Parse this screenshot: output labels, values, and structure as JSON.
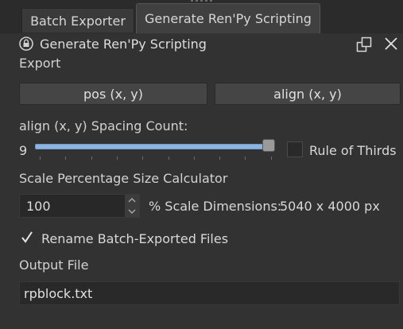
{
  "tabs": [
    {
      "label": "Batch Exporter",
      "active": false
    },
    {
      "label": "Generate Ren'Py Scripting",
      "active": true
    }
  ],
  "dock": {
    "title": "Generate Ren'Py Scripting",
    "icons": {
      "lock": "lock-icon",
      "float": "float-icon",
      "close": "close-icon"
    }
  },
  "export": {
    "label": "Export",
    "pos_button": "pos (x, y)",
    "align_button": "align (x, y)"
  },
  "spacing": {
    "label": "align (x, y) Spacing Count:",
    "value_text": "9",
    "slider_fraction": 0.98,
    "rule_of_thirds_label": "Rule of Thirds",
    "rule_of_thirds_checked": false
  },
  "scale": {
    "label": "Scale Percentage Size Calculator",
    "value": "100",
    "suffix": "% Scale Dimensions:",
    "dimensions": "5040 x 4000 px"
  },
  "rename": {
    "label": "Rename Batch-Exported Files",
    "checked": true
  },
  "output": {
    "label": "Output File",
    "value": "rpblock.txt"
  },
  "colors": {
    "background": "#323232",
    "slider_fill": "#8cb4e0",
    "active_tab": "#404040"
  }
}
